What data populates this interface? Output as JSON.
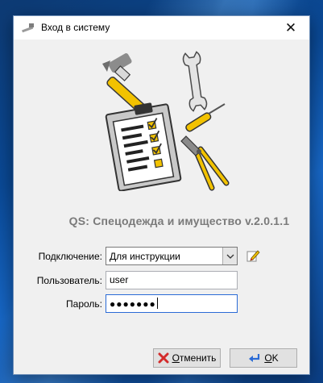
{
  "window": {
    "title": "Вход в систему",
    "close_glyph": "✕"
  },
  "app": {
    "title": "QS: Спецодежда и имущество v.2.0.1.1",
    "illustration_icons": [
      "hammer-icon",
      "wrench-icon",
      "screwdriver-icon",
      "pliers-icon",
      "clipboard-checklist-icon"
    ]
  },
  "form": {
    "connection": {
      "label": "Подключение:",
      "value": "Для инструкции",
      "edit_icon": "pencil-edit-icon"
    },
    "user": {
      "label": "Пользователь:",
      "value": "user"
    },
    "password": {
      "label": "Пароль:",
      "masked_value": "●●●●●●●"
    }
  },
  "buttons": {
    "cancel": {
      "accel": "О",
      "rest": "тменить",
      "icon": "red-x-icon"
    },
    "ok": {
      "accel": "O",
      "rest": "K",
      "icon": "enter-arrow-icon"
    }
  },
  "colors": {
    "accent_yellow": "#f2c200",
    "cancel_red": "#d32b2b",
    "focus_border": "#2a6bd6",
    "title_gray": "#7a7a7a"
  }
}
